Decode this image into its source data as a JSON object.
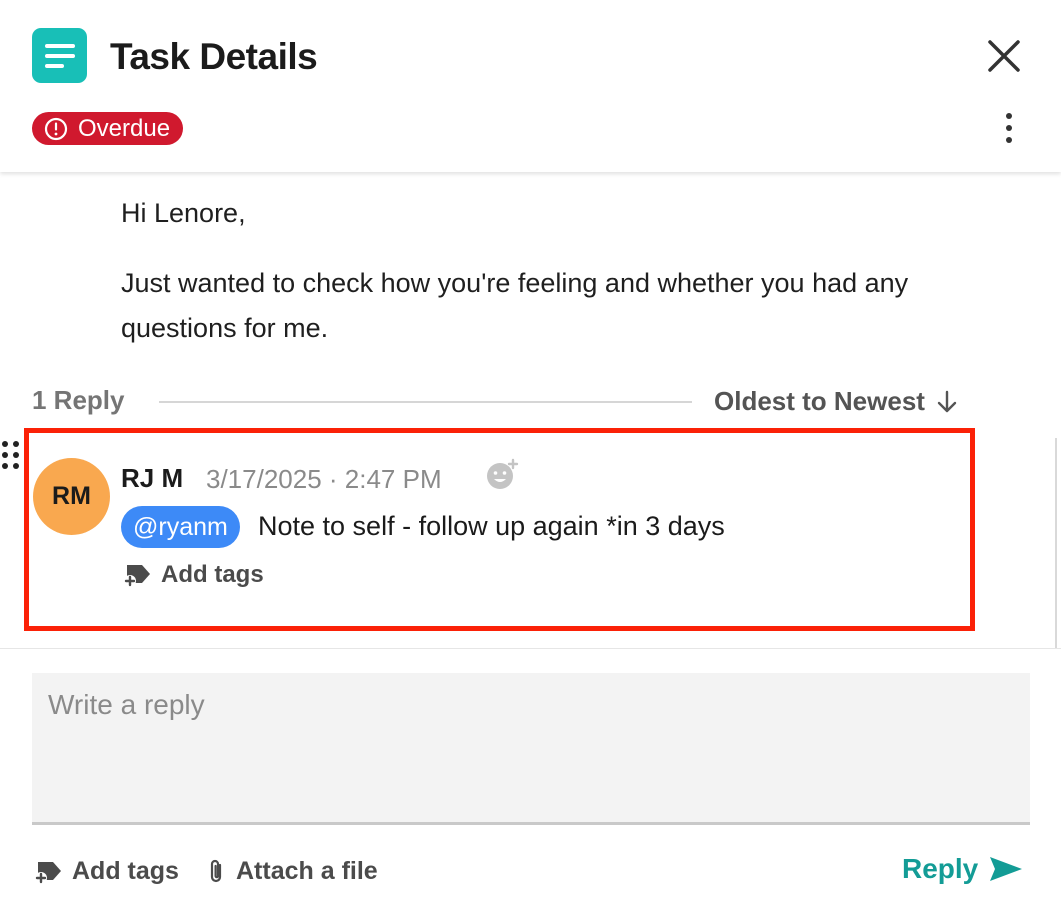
{
  "header": {
    "title": "Task Details",
    "status_badge": "Overdue",
    "app_icon": "task-list-icon",
    "colors": {
      "accent": "#18bfb7",
      "overdue": "#d0192e"
    }
  },
  "message": {
    "greeting": "Hi Lenore,",
    "body": "Just wanted to check how you're feeling and whether you had any questions for me."
  },
  "replies": {
    "count_label": "1 Reply",
    "sort_label": "Oldest to Newest",
    "items": [
      {
        "avatar_initials": "RM",
        "author": "RJ M",
        "timestamp": "3/17/2025 · 2:47 PM",
        "mention": "@ryanm",
        "text": "Note to self - follow up again *in 3 days",
        "add_tags_label": "Add tags"
      }
    ]
  },
  "composer": {
    "placeholder": "Write a reply",
    "add_tags_label": "Add tags",
    "attach_label": "Attach a file",
    "reply_label": "Reply",
    "colors": {
      "reply": "#139c96"
    }
  }
}
